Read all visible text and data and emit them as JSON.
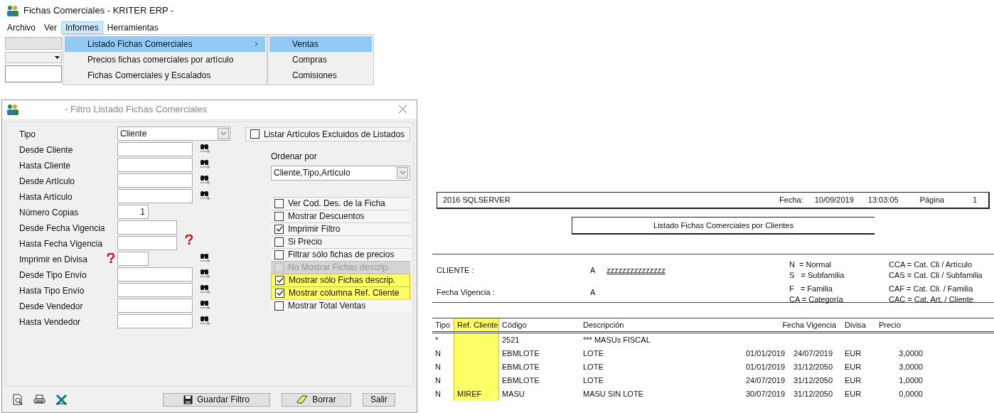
{
  "window": {
    "title": "Fichas Comerciales - KRITER ERP -"
  },
  "menu_bar": [
    {
      "label": "Archivo",
      "selected": false
    },
    {
      "label": "Ver",
      "selected": false
    },
    {
      "label": "Informes",
      "selected": true
    },
    {
      "label": "Herramientas",
      "selected": false
    }
  ],
  "menu": [
    {
      "label": "Listado Fichas Comerciales",
      "selected": true,
      "submenu": true
    },
    {
      "label": "Precios fichas comerciales por artículo",
      "selected": false,
      "submenu": false
    },
    {
      "label": "Fichas Comerciales y Escalados",
      "selected": false,
      "submenu": false
    }
  ],
  "submenu": [
    {
      "label": "Ventas",
      "selected": true
    },
    {
      "label": "Compras",
      "selected": false
    },
    {
      "label": "Comisiones",
      "selected": false
    }
  ],
  "dialog": {
    "title": "- Filtro Listado Fichas Comerciales",
    "fields": [
      {
        "label": "Tipo",
        "kind": "combo",
        "value": "Cliente"
      },
      {
        "label": "Desde Cliente",
        "kind": "search"
      },
      {
        "label": "Hasta Cliente",
        "kind": "search"
      },
      {
        "label": "Desde Artículo",
        "kind": "search"
      },
      {
        "label": "Hasta Artículo",
        "kind": "search"
      },
      {
        "label": "Número Copias",
        "kind": "number",
        "value": "1"
      },
      {
        "label": "Desde Fecha Vigencia",
        "kind": "date"
      },
      {
        "label": "Hasta Fecha Vigencia",
        "kind": "date"
      },
      {
        "label": "Imprimir en Divisa",
        "kind": "currency"
      },
      {
        "label": "Desde Tipo Envío",
        "kind": "search"
      },
      {
        "label": "Hasta Tipo Envío",
        "kind": "search"
      },
      {
        "label": "Desde Vendedor",
        "kind": "search"
      },
      {
        "label": "Hasta Vendedor",
        "kind": "search"
      }
    ],
    "exclude_checkbox": {
      "label": "Listar Artículos Excluidos de Listados",
      "checked": false
    },
    "order_by": {
      "label": "Ordenar por",
      "value": "Cliente,Tipo,Artículo"
    },
    "options": [
      {
        "label": "Ver Cod. Des. de la Ficha",
        "checked": false,
        "disabled": false,
        "highlighted": false
      },
      {
        "label": "Mostrar Descuentos",
        "checked": false,
        "disabled": false,
        "highlighted": false
      },
      {
        "label": "Imprimir Filtro",
        "checked": true,
        "disabled": false,
        "highlighted": false
      },
      {
        "label": "Si Precio",
        "checked": false,
        "disabled": false,
        "highlighted": false
      },
      {
        "label": "Filtrar sólo fichas de precios",
        "checked": false,
        "disabled": false,
        "highlighted": false
      },
      {
        "label": "No Mostrar Fichas descrip.",
        "checked": false,
        "disabled": true,
        "highlighted": false
      },
      {
        "label": "Mostrar sólo Fichas descrip.",
        "checked": true,
        "disabled": false,
        "highlighted": true
      },
      {
        "label": "Mostrar columna Ref. Cliente",
        "checked": true,
        "disabled": false,
        "highlighted": true
      },
      {
        "label": "Mostrar Total Ventas",
        "checked": false,
        "disabled": false,
        "highlighted": false
      }
    ],
    "buttons": [
      {
        "label": "Guardar Filtro",
        "kind": "save"
      },
      {
        "label": "Borrar",
        "kind": "erase"
      },
      {
        "label": "Salir",
        "kind": "exit"
      }
    ]
  },
  "report": {
    "server": "2016 SQLSERVER",
    "date_label": "Fecha:",
    "date": "10/09/2019",
    "time": "13:03:05",
    "page_label": "Página",
    "page": "1",
    "title": "Listado Fichas Comerciales por Clientes",
    "filters": [
      {
        "label": "CLIENTE :",
        "from": "A",
        "to": "zzzzzzzzzzzzzzz"
      },
      {
        "label": "Fecha Vigencia :",
        "from": "A"
      }
    ],
    "legend": [
      [
        "N  = Normal",
        "S   = Subfamilia",
        "F   = Familia",
        "CA = Categoría"
      ],
      [
        "CCA = Cat. Cli / Artículo",
        "CAS = Cat. Cli / Subfamilia",
        "CAF = Cat. Cli. / Familia",
        "CAC = Cat. Art. / Cliente"
      ]
    ],
    "columns": [
      {
        "label": "Tipo",
        "highlighted": false
      },
      {
        "label": "Ref. Cliente",
        "highlighted": true
      },
      {
        "label": "Código",
        "highlighted": false
      },
      {
        "label": "Descripción",
        "highlighted": false
      },
      {
        "label": "Fecha Vigencia",
        "highlighted": false,
        "colspan": 2
      },
      {
        "label": "Divisa",
        "highlighted": false
      },
      {
        "label": "Precio",
        "highlighted": false
      }
    ],
    "rows": [
      [
        "*",
        "",
        "2521",
        "*** MASUs FISCAL",
        "",
        "",
        "",
        ""
      ],
      [
        "N",
        "",
        "EBMLOTE",
        "LOTE",
        "01/01/2019",
        "24/07/2019",
        "EUR",
        "3,0000"
      ],
      [
        "N",
        "",
        "EBMLOTE",
        "LOTE",
        "01/01/2019",
        "31/12/2050",
        "EUR",
        "3,0000"
      ],
      [
        "N",
        "",
        "EBMLOTE",
        "LOTE",
        "24/07/2019",
        "31/12/2050",
        "EUR",
        "1,0000"
      ],
      [
        "N",
        "MIREF",
        "MASU",
        "MASU SIN LOTE",
        "30/07/2019",
        "31/12/2050",
        "EUR",
        "0,0000"
      ]
    ]
  }
}
